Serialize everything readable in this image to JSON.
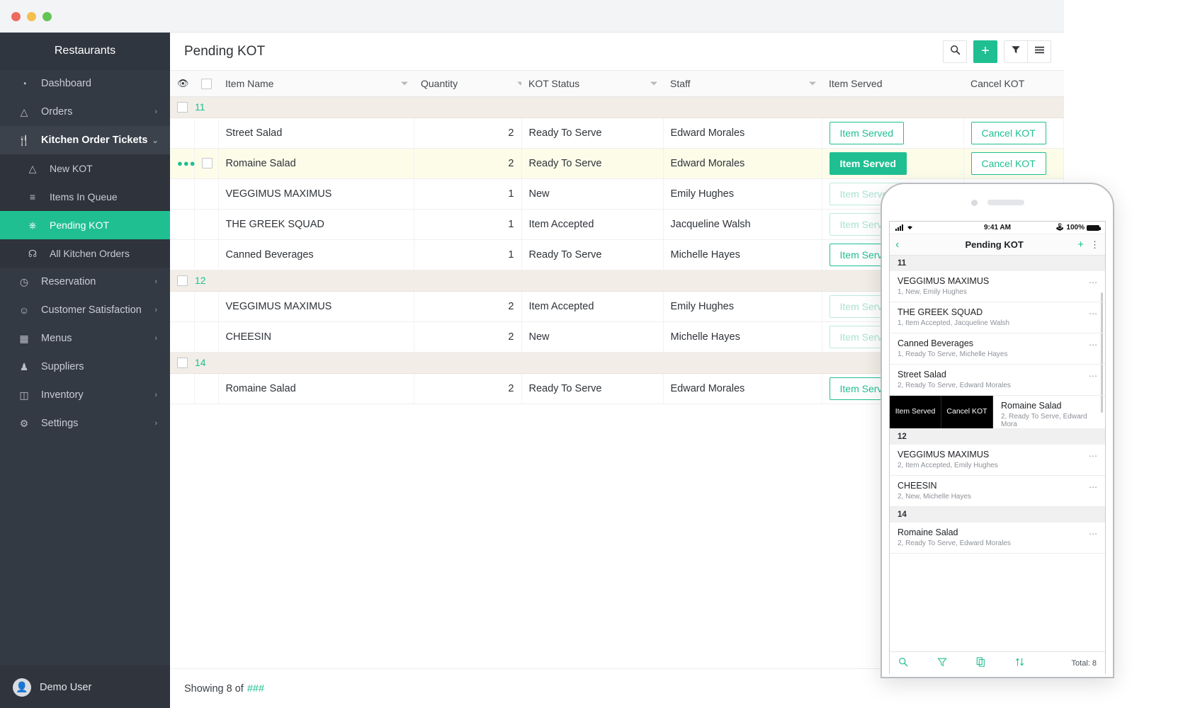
{
  "window": {
    "dots": [
      "close",
      "minimize",
      "maximize"
    ]
  },
  "sidebar": {
    "brand": "Restaurants",
    "items": [
      {
        "label": "Dashboard",
        "icon": "gauge-icon",
        "chevron": ""
      },
      {
        "label": "Orders",
        "icon": "bell-icon",
        "chevron": "›"
      },
      {
        "label": "Kitchen Order Tickets",
        "icon": "cutlery-icon",
        "chevron": "⌄"
      },
      {
        "label": "New KOT",
        "icon": "chef-hat-icon",
        "chevron": ""
      },
      {
        "label": "Items In Queue",
        "icon": "list-icon",
        "chevron": ""
      },
      {
        "label": "Pending KOT",
        "icon": "tray-icon",
        "chevron": ""
      },
      {
        "label": "All Kitchen Orders",
        "icon": "pot-icon",
        "chevron": ""
      },
      {
        "label": "Reservation",
        "icon": "clock-icon",
        "chevron": "›"
      },
      {
        "label": "Customer Satisfaction",
        "icon": "people-chat-icon",
        "chevron": "›"
      },
      {
        "label": "Menus",
        "icon": "book-icon",
        "chevron": "›"
      },
      {
        "label": "Suppliers",
        "icon": "group-icon",
        "chevron": ""
      },
      {
        "label": "Inventory",
        "icon": "box-icon",
        "chevron": "›"
      },
      {
        "label": "Settings",
        "icon": "gear-icon",
        "chevron": "›"
      }
    ],
    "active_label": "Pending KOT",
    "user": {
      "name": "Demo User",
      "avatar_icon": "user-icon"
    }
  },
  "header": {
    "title": "Pending KOT",
    "buttons": [
      {
        "name": "search-button",
        "icon": "search-icon",
        "label": ""
      },
      {
        "name": "add-button",
        "icon": "plus-icon",
        "label": "+"
      },
      {
        "name": "filter-button",
        "icon": "filter-icon",
        "label": ""
      },
      {
        "name": "menu-button",
        "icon": "hamburger-icon",
        "label": ""
      }
    ]
  },
  "table": {
    "columns": [
      "Item Name",
      "Quantity",
      "KOT Status",
      "Staff",
      "Item Served",
      "Cancel KOT"
    ],
    "groups": [
      {
        "id": "11",
        "rows": [
          {
            "name": "Street Salad",
            "qty": "2",
            "status": "Ready To Serve",
            "staff": "Edward Morales",
            "served_state": "outline",
            "cancel_state": "outline",
            "row_menu": false,
            "row_checkbox": false,
            "highlight": false
          },
          {
            "name": "Romaine Salad",
            "qty": "2",
            "status": "Ready To Serve",
            "staff": "Edward Morales",
            "served_state": "solid",
            "cancel_state": "outline",
            "row_menu": true,
            "row_checkbox": true,
            "highlight": true
          },
          {
            "name": "VEGGIMUS MAXIMUS",
            "qty": "1",
            "status": "New",
            "staff": "Emily Hughes",
            "served_state": "disabled",
            "cancel_state": "outline",
            "row_menu": false,
            "row_checkbox": false,
            "highlight": false
          },
          {
            "name": "THE GREEK SQUAD",
            "qty": "1",
            "status": "Item Accepted",
            "staff": "Jacqueline Walsh",
            "served_state": "disabled",
            "cancel_state": "outline",
            "row_menu": false,
            "row_checkbox": false,
            "highlight": false
          },
          {
            "name": "Canned Beverages",
            "qty": "1",
            "status": "Ready To Serve",
            "staff": "Michelle Hayes",
            "served_state": "outline",
            "cancel_state": "outline",
            "row_menu": false,
            "row_checkbox": false,
            "highlight": false
          }
        ]
      },
      {
        "id": "12",
        "rows": [
          {
            "name": "VEGGIMUS MAXIMUS",
            "qty": "2",
            "status": "Item Accepted",
            "staff": "Emily Hughes",
            "served_state": "disabled",
            "cancel_state": "outline",
            "row_menu": false,
            "row_checkbox": false,
            "highlight": false
          },
          {
            "name": "CHEESIN",
            "qty": "2",
            "status": "New",
            "staff": "Michelle Hayes",
            "served_state": "disabled",
            "cancel_state": "outline",
            "row_menu": false,
            "row_checkbox": false,
            "highlight": false
          }
        ]
      },
      {
        "id": "14",
        "rows": [
          {
            "name": "Romaine Salad",
            "qty": "2",
            "status": "Ready To Serve",
            "staff": "Edward Morales",
            "served_state": "outline",
            "cancel_state": "outline",
            "row_menu": false,
            "row_checkbox": false,
            "highlight": false
          }
        ]
      }
    ],
    "served_label": "Item Served",
    "cancel_label": "Cancel KOT"
  },
  "footer": {
    "text": "Showing 8 of",
    "count": "###"
  },
  "phone": {
    "status": {
      "time": "9:41 AM",
      "battery": "100%",
      "bluetooth_icon": "bluetooth-icon",
      "signal_icon": "signal-icon",
      "wifi_icon": "wifi-icon"
    },
    "nav": {
      "back_icon": "chevron-left-icon",
      "title": "Pending KOT",
      "add_icon": "plus-icon",
      "more_icon": "more-vertical-icon"
    },
    "list": [
      {
        "type": "group",
        "label": "11"
      },
      {
        "type": "row",
        "title": "VEGGIMUS MAXIMUS",
        "sub": "1, New, Emily Hughes"
      },
      {
        "type": "row",
        "title": "THE GREEK SQUAD",
        "sub": "1, Item Accepted, Jacqueline Walsh"
      },
      {
        "type": "row",
        "title": "Canned Beverages",
        "sub": "1, Ready To Serve, Michelle Hayes"
      },
      {
        "type": "row",
        "title": "Street Salad",
        "sub": "2, Ready To Serve, Edward Morales"
      },
      {
        "type": "swiped",
        "title": "Romaine Salad",
        "sub": "2, Ready To Serve, Edward Mora",
        "action1": "Item Served",
        "action2": "Cancel KOT"
      },
      {
        "type": "group",
        "label": "12"
      },
      {
        "type": "row",
        "title": "VEGGIMUS MAXIMUS",
        "sub": "2, Item Accepted, Emily Hughes"
      },
      {
        "type": "row",
        "title": "CHEESIN",
        "sub": "2, New, Michelle Hayes"
      },
      {
        "type": "group",
        "label": "14"
      },
      {
        "type": "row",
        "title": "Romaine Salad",
        "sub": "2, Ready To Serve, Edward Morales"
      }
    ],
    "tools": {
      "search_icon": "search-icon",
      "filter_icon": "filter-icon",
      "copy_icon": "copy-icon",
      "sort_icon": "sort-icon",
      "total": "Total: 8"
    }
  },
  "colors": {
    "accent": "#1fbf92",
    "sidebar": "#343a44",
    "group_row": "#f2eee7",
    "highlight_row": "#fcfce9"
  }
}
